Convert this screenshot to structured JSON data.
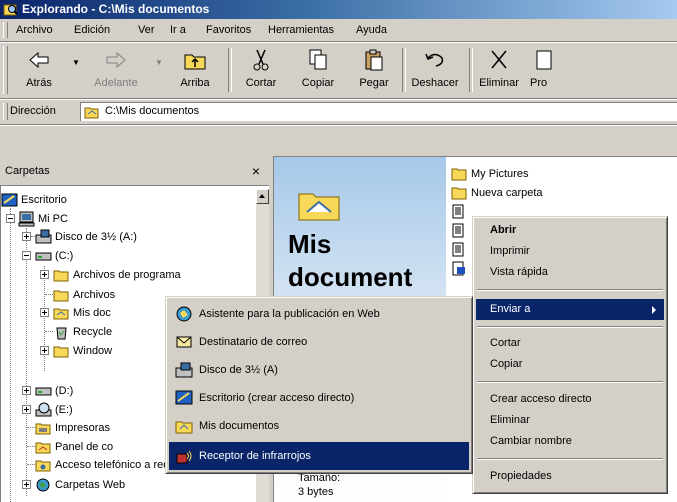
{
  "window": {
    "title": "Explorando - C:\\Mis documentos"
  },
  "menubar": [
    "Archivo",
    "Edición",
    "Ver",
    "Ir a",
    "Favoritos",
    "Herramientas",
    "Ayuda"
  ],
  "toolbar": {
    "back": "Atrás",
    "forward": "Adelante",
    "up": "Arriba",
    "cut": "Cortar",
    "copy": "Copiar",
    "paste": "Pegar",
    "undo": "Deshacer",
    "delete": "Eliminar",
    "properties_partial": "Pro"
  },
  "address": {
    "label": "Dirección",
    "value": "C:\\Mis documentos"
  },
  "folders_panel": {
    "title": "Carpetas",
    "close": "×",
    "tree": [
      "Escritorio",
      "Mi PC",
      "Disco de 3½ (A:)",
      "(C:)",
      "Archivos de programa",
      "Archivos",
      "Mis doc",
      "Recycle",
      "Window",
      "(D:)",
      "(E:)",
      "Impresoras",
      "Panel de co",
      "Acceso telefónico a redes",
      "Carpetas Web"
    ]
  },
  "content": {
    "big_title_line1": "Mis",
    "big_title_line2": "document",
    "size_label": "Tamaño:",
    "size_value": "3 bytes",
    "files": [
      "My Pictures",
      "Nueva carpeta"
    ]
  },
  "context_menu": {
    "items": [
      "Abrir",
      "Imprimir",
      "Vista rápida",
      "Enviar a",
      "Cortar",
      "Copiar",
      "Crear acceso directo",
      "Eliminar",
      "Cambiar nombre",
      "Propiedades"
    ],
    "selected": "Enviar a"
  },
  "sendto_menu": {
    "items": [
      "Asistente para la publicación en Web",
      "Destinatario de correo",
      "Disco de 3½ (A)",
      "Escritorio (crear acceso directo)",
      "Mis documentos",
      "Receptor de infrarrojos"
    ],
    "selected": "Receptor de infrarrojos"
  },
  "colors": {
    "selection": "#0a246a",
    "face": "#d4d0c8",
    "folder": "#f8d858"
  }
}
